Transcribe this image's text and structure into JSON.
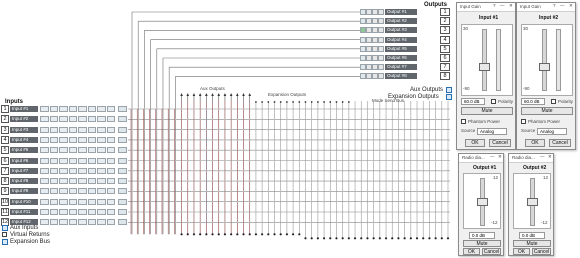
{
  "matrix": {
    "outputs_title": "Outputs",
    "inputs_title": "Inputs",
    "aux_outputs_label": "Aux Outputs",
    "expansion_outputs_label": "Expansion Outputs",
    "aux_outputs_caption": "Aux Outputs",
    "expansion_outputs_caption": "Expansion Outputs",
    "mode_send_bus_caption": "Mode Send Bus",
    "output_numbers": [
      "1",
      "2",
      "3",
      "4",
      "5",
      "6",
      "7",
      "8"
    ],
    "output_names": [
      "Output #1",
      "Output #2",
      "Output #3",
      "Output #4",
      "Output #5",
      "Output #6",
      "Output #7",
      "Output #8"
    ],
    "input_numbers": [
      "1",
      "2",
      "3",
      "4",
      "5",
      "6",
      "7",
      "8",
      "9",
      "10",
      "11",
      "12"
    ],
    "input_names": [
      "Input #1",
      "Input #2",
      "Input #3",
      "Input #4",
      "Input #5",
      "Input #6",
      "Input #7",
      "Input #8",
      "Input #9",
      "Input #10",
      "Input #11",
      "Input #12"
    ],
    "legend": [
      {
        "label": "Aux Inputs",
        "checked": true
      },
      {
        "label": "Virtual Returns",
        "checked": false
      },
      {
        "label": "Expansion Bus",
        "checked": true
      }
    ],
    "accent_color": "#4a7fb5",
    "wire_color": "#8c2f2f",
    "grid_color": "#9a9a9a"
  },
  "input1_panel": {
    "title": "Input Gain",
    "heading": "Input #1",
    "scale_top": "30",
    "scale_bottom": "-90",
    "value": "60.0 dB",
    "polarity_label": "Polarity",
    "mute_label": "Mute",
    "phantom_label": "Phantom Power",
    "source_label": "Source",
    "source_value": "Analog",
    "ok": "OK",
    "cancel": "Cancel",
    "fader_level": 0.38
  },
  "input2_panel": {
    "title": "Input Gain",
    "heading": "Input #2",
    "scale_top": "30",
    "scale_bottom": "-90",
    "value": "60.0 dB",
    "polarity_label": "Polarity",
    "mute_label": "Mute",
    "phantom_label": "Phantom Power",
    "source_label": "Source",
    "source_value": "Analog",
    "ok": "OK",
    "cancel": "Cancel",
    "fader_level": 0.38
  },
  "output1_panel": {
    "title": "Radio dia...",
    "heading": "Output #1",
    "scale_top": "12",
    "scale_bottom": "-12",
    "value": "0.0 dB",
    "mute_label": "Mute",
    "ok": "OK",
    "cancel": "Cancel",
    "fader_level": 0.5
  },
  "output2_panel": {
    "title": "Radio dia...",
    "heading": "Output #2",
    "scale_top": "12",
    "scale_bottom": "-12",
    "value": "0.0 dB",
    "mute_label": "Mute",
    "ok": "OK",
    "cancel": "Cancel",
    "fader_level": 0.5
  }
}
